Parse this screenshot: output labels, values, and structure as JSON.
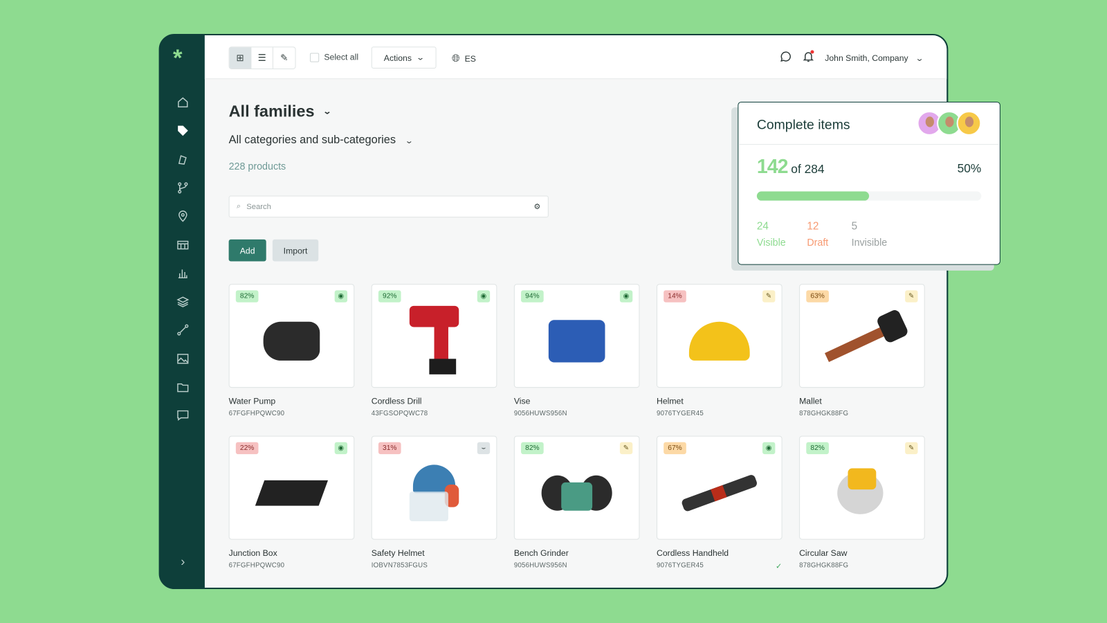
{
  "colors": {
    "brand": "#0e3f3a",
    "accent": "#8edb90",
    "draft": "#f79a72",
    "invisible": "#9aa0a0",
    "button": "#2f7a6b"
  },
  "sidebar": {
    "logo": "*",
    "items": [
      {
        "icon": "home-icon"
      },
      {
        "icon": "tag-icon",
        "active": true
      },
      {
        "icon": "cards-icon"
      },
      {
        "icon": "branch-icon"
      },
      {
        "icon": "location-pin-icon"
      },
      {
        "icon": "table-icon"
      },
      {
        "icon": "bar-chart-icon"
      },
      {
        "icon": "layers-icon"
      },
      {
        "icon": "route-icon"
      },
      {
        "icon": "image-icon"
      },
      {
        "icon": "folder-icon"
      },
      {
        "icon": "chat-icon"
      }
    ],
    "expand": "›"
  },
  "toolbar": {
    "select_all": "Select all",
    "actions": "Actions",
    "language": "ES",
    "user": "John Smith, Company"
  },
  "header": {
    "title": "All families",
    "categories": "All categories and sub-categories",
    "count": "228 products"
  },
  "search": {
    "placeholder": "Search"
  },
  "buttons": {
    "add": "Add",
    "import": "Import"
  },
  "products": [
    {
      "name": "Water Pump",
      "sku": "67FGFHPQWC90",
      "completion": "82%",
      "level": "g",
      "status": "visible"
    },
    {
      "name": "Cordless Drill",
      "sku": "43FGSOPQWC78",
      "completion": "92%",
      "level": "g",
      "status": "visible"
    },
    {
      "name": "Vise",
      "sku": "9056HUWS956N",
      "completion": "94%",
      "level": "g",
      "status": "visible"
    },
    {
      "name": "Helmet",
      "sku": "9076TYGER45",
      "completion": "14%",
      "level": "r",
      "status": "draft"
    },
    {
      "name": "Mallet",
      "sku": "878GHGK88FG",
      "completion": "63%",
      "level": "o",
      "status": "draft"
    },
    {
      "name": "Junction Box",
      "sku": "67FGFHPQWC90",
      "completion": "22%",
      "level": "r",
      "status": "visible"
    },
    {
      "name": "Safety Helmet",
      "sku": "IOBVN7853FGUS",
      "completion": "31%",
      "level": "r",
      "status": "invisible"
    },
    {
      "name": "Bench Grinder",
      "sku": "9056HUWS956N",
      "completion": "82%",
      "level": "g",
      "status": "draft"
    },
    {
      "name": "Cordless Handheld",
      "sku": "9076TYGER45",
      "completion": "67%",
      "level": "o",
      "status": "visible",
      "checked": true
    },
    {
      "name": "Circular Saw",
      "sku": "878GHGK88FG",
      "completion": "82%",
      "level": "g",
      "status": "draft"
    }
  ],
  "complete_panel": {
    "title": "Complete items",
    "done": "142",
    "of_label": "of 284",
    "percent_label": "50%",
    "progress": 0.5,
    "stats": [
      {
        "value": "24",
        "label": "Visible"
      },
      {
        "value": "12",
        "label": "Draft"
      },
      {
        "value": "5",
        "label": "Invisible"
      }
    ]
  }
}
